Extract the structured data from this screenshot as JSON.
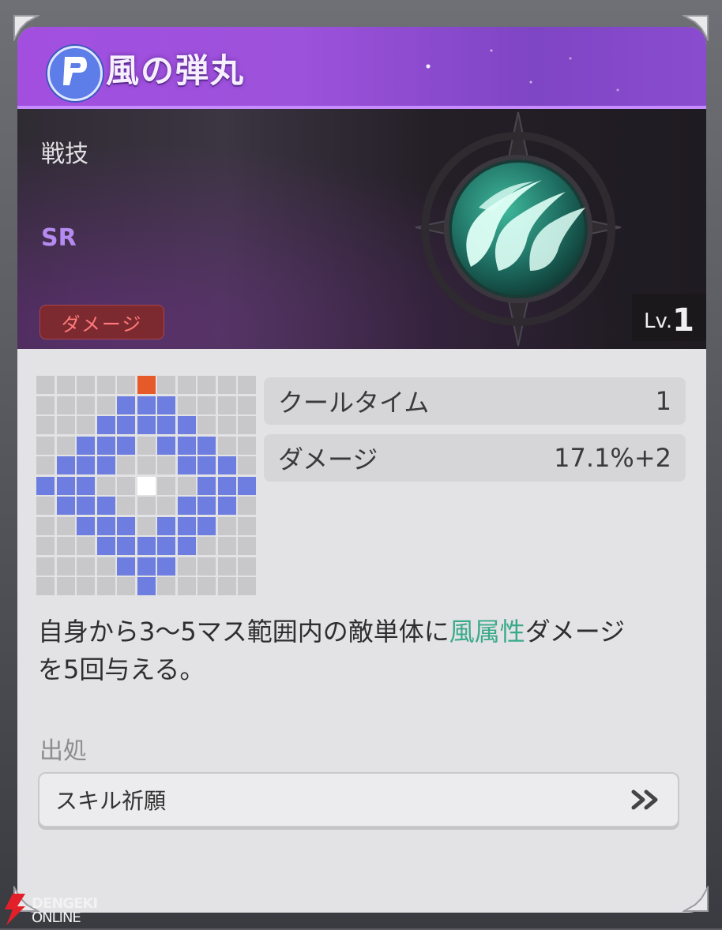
{
  "card": {
    "title": "風の弾丸",
    "category": "戦技",
    "rarity": "SR",
    "type_tag": "ダメージ",
    "level_prefix": "Lv.",
    "level": "1"
  },
  "range_grid": {
    "size": 11,
    "origin": [
      6,
      5
    ],
    "target": [
      0,
      5
    ],
    "rows": [
      "00000o00000",
      "00000bbb000",
      "000bbbbb00",
      "0000bbbbbb000",
      "00bbb0bbb00",
      "0bbb000bbb0",
      "bbb00w00bbb",
      "0bbb000bbb0",
      "00bbb0bbb00",
      "000bbbbb000",
      "0000bbb0000",
      "00000b00000"
    ]
  },
  "stats": [
    {
      "label": "クールタイム",
      "value": "1"
    },
    {
      "label": "ダメージ",
      "value": "17.1%+2"
    }
  ],
  "description": {
    "part1": "自身から3〜5マス範囲内の敵単体に",
    "highlight": "風属性",
    "part2": "ダメージ",
    "line2": "を5回与える。"
  },
  "source": {
    "label": "出処",
    "button_label": "スキル祈願",
    "button_icon": "double-chevron-right-icon"
  },
  "watermark": {
    "line1": "DENGEKI",
    "line2": "ONLINE"
  },
  "colors": {
    "title_bar": "#9d52db",
    "rarity": "#b58bf0",
    "damage_tag": "#ff7a7a",
    "range_cell": "#6d7ee0",
    "target_cell": "#e65a2a",
    "element_highlight": "#3aa98a"
  }
}
